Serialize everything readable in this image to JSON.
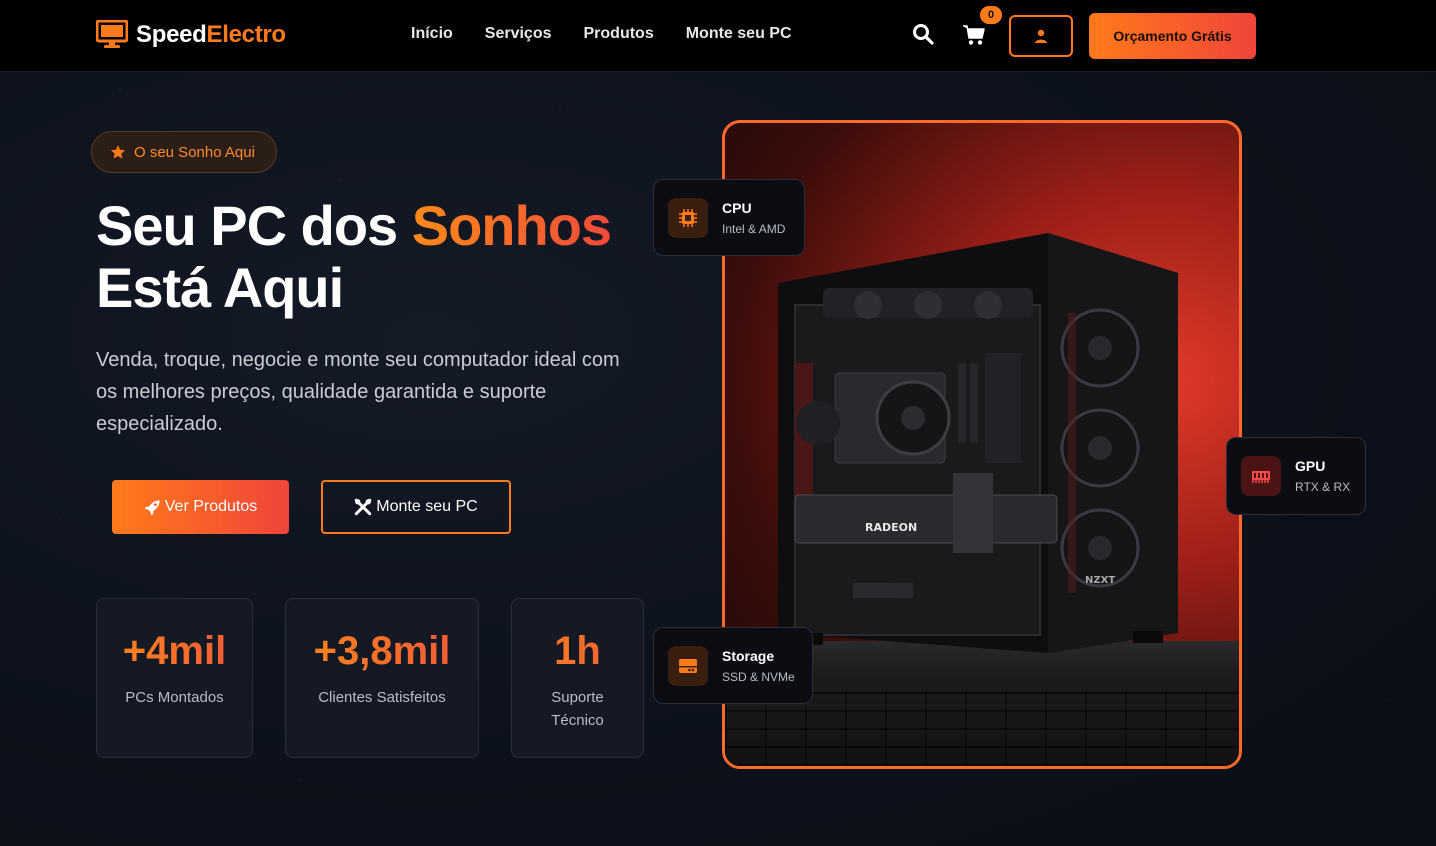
{
  "brand": {
    "part1": "Speed",
    "part2": "Electro",
    "accent_color": "#ff7a1a"
  },
  "nav": {
    "links": [
      {
        "label": "Início"
      },
      {
        "label": "Serviços"
      },
      {
        "label": "Produtos"
      },
      {
        "label": "Monte seu PC"
      }
    ],
    "search_icon": "search-icon",
    "cart_icon": "cart-icon",
    "cart_count": "0",
    "user_icon": "user-icon",
    "quote_button": "Orçamento Grátis"
  },
  "hero": {
    "badge": {
      "icon": "star-icon",
      "text": "O seu Sonho Aqui"
    },
    "title_part1": "Seu PC dos ",
    "title_accent": "Sonhos",
    "title_line2": "Está Aqui",
    "description": "Venda, troque, negocie e monte seu computador ideal com os melhores preços, qualidade garantida e suporte especializado.",
    "primary_button": {
      "icon": "rocket-icon",
      "label": "Ver Produtos"
    },
    "secondary_button": {
      "icon": "tools-icon",
      "label": "Monte seu PC"
    }
  },
  "stats": [
    {
      "value": "+4mil",
      "label": "PCs Montados"
    },
    {
      "value": "+3,8mil",
      "label": "Clientes Satisfeitos"
    },
    {
      "value": "1h",
      "label_line1": "Suporte",
      "label_line2": "Técnico"
    }
  ],
  "feature_cards": {
    "cpu": {
      "icon": "cpu-icon",
      "title": "CPU",
      "subtitle": "Intel & AMD"
    },
    "gpu": {
      "icon": "memory-icon",
      "title": "GPU",
      "subtitle": "RTX & RX"
    },
    "storage": {
      "icon": "hdd-icon",
      "title": "Storage",
      "subtitle": "SSD & NVMe"
    }
  },
  "product_image": {
    "gpu_brand": "RADEON",
    "case_brand": "NZXT"
  }
}
